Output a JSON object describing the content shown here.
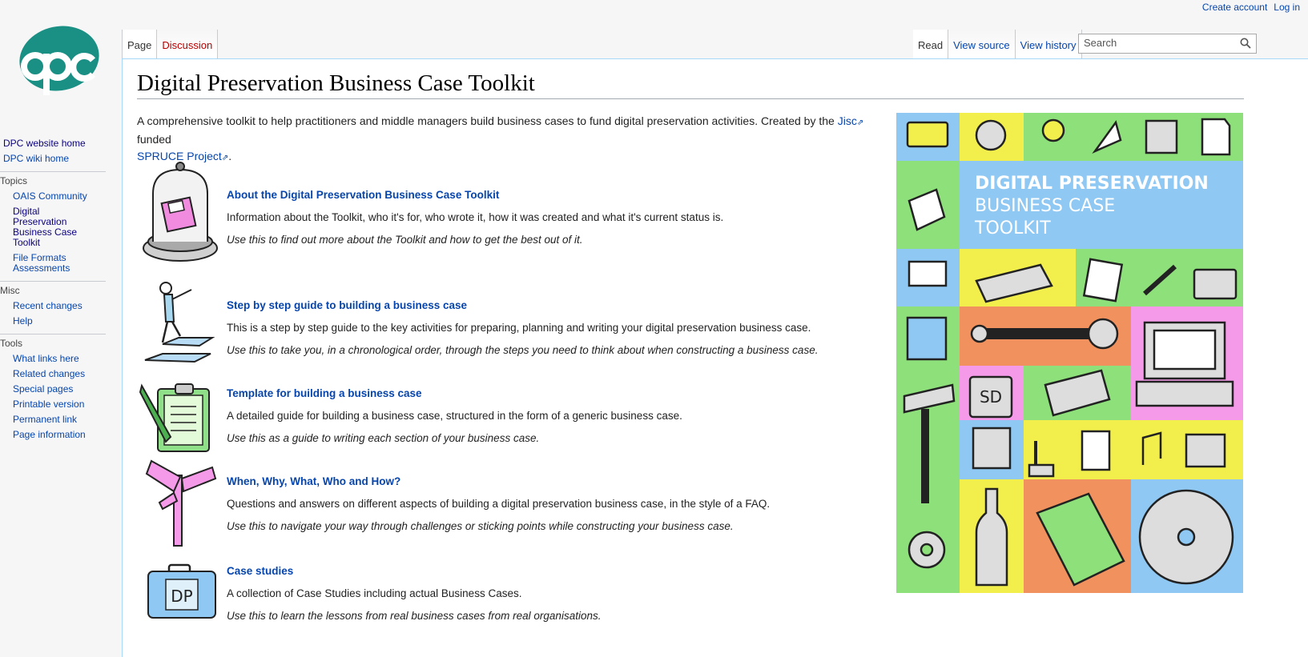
{
  "personal": {
    "create_account": "Create account",
    "login": "Log in"
  },
  "logo": {
    "text": "dpc",
    "color": "#1a8f84"
  },
  "nav": {
    "items": [
      "DPC website home",
      "DPC wiki home"
    ]
  },
  "topics": {
    "heading": "Topics",
    "items": [
      "OAIS Community",
      "Digital Preservation Business Case Toolkit",
      "File Formats Assessments"
    ]
  },
  "misc": {
    "heading": "Misc",
    "items": [
      "Recent changes",
      "Help"
    ]
  },
  "tools": {
    "heading": "Tools",
    "items": [
      "What links here",
      "Related changes",
      "Special pages",
      "Printable version",
      "Permanent link",
      "Page information"
    ]
  },
  "tabs": {
    "page": "Page",
    "discussion": "Discussion",
    "read": "Read",
    "view_source": "View source",
    "view_history": "View history"
  },
  "search": {
    "placeholder": "Search"
  },
  "page": {
    "title": "Digital Preservation Business Case Toolkit",
    "intro_text": "A comprehensive toolkit to help practitioners and middle managers build business cases to fund digital preservation activities. Created by the",
    "jisc": "Jisc",
    "funded": "funded",
    "spruce": "SPRUCE Project",
    "period": "."
  },
  "sections": [
    {
      "title": "About the Digital Preservation Business Case Toolkit",
      "desc": "Information about the Toolkit, who it's for, who wrote it, how it was created and what it's current status is.",
      "use": "Use this to find out more about the Toolkit and how to get the best out of it.",
      "icon": "bell-jar-floppy-icon"
    },
    {
      "title": "Step by step guide to building a business case",
      "desc": "This is a step by step guide to the key activities for preparing, planning and writing your digital preservation business case.",
      "use": "Use this to take you, in a chronological order, through the steps you need to think about when constructing a business case.",
      "icon": "stairs-figure-icon"
    },
    {
      "title": "Template for building a business case",
      "desc": "A detailed guide for building a business case, structured in the form of a generic business case.",
      "use": "Use this as a guide to writing each section of your business case.",
      "icon": "clipboard-pencil-icon"
    },
    {
      "title": "When, Why, What, Who and How?",
      "desc": "Questions and answers on different aspects of building a digital preservation business case, in the style of a FAQ.",
      "use": "Use this to navigate your way through challenges or sticking points while constructing your business case.",
      "icon": "signpost-icon"
    },
    {
      "title": "Case studies",
      "desc": "A collection of Case Studies including actual Business Cases.",
      "use": "Use this to learn the lessons from real business cases from real organisations.",
      "icon": "dp-briefcase-icon"
    }
  ],
  "cover": {
    "line1": "DIGITAL PRESERVATION",
    "line2": "BUSINESS CASE",
    "line3": "TOOLKIT",
    "sd_label": "SD",
    "dp_label": "DP"
  },
  "colors": {
    "green": "#8ee07a",
    "yellow": "#f2ee4c",
    "blue": "#8fc8f3",
    "pink": "#f59ae8",
    "orange": "#f0915e",
    "link": "#0645ad"
  }
}
